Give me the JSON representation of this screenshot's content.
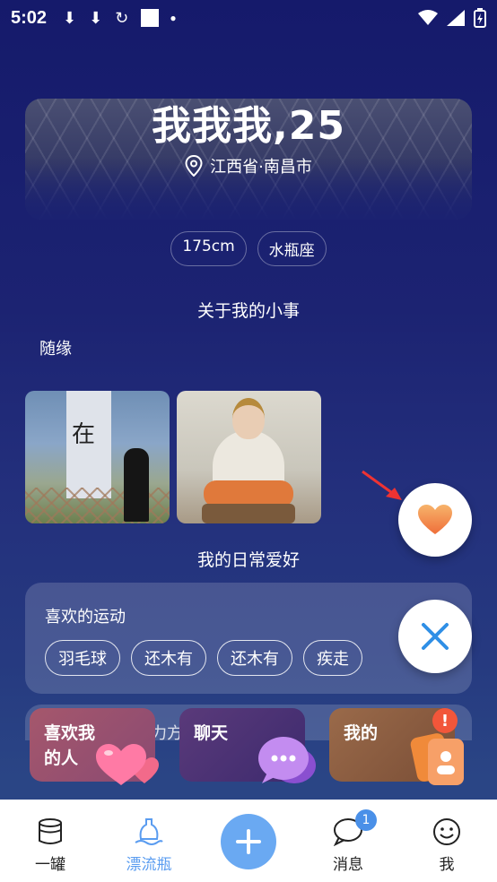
{
  "status_bar": {
    "time": "5:02"
  },
  "profile": {
    "name_age": "我我我,25",
    "location": "江西省·南昌市",
    "tags": [
      "175cm",
      "水瓶座"
    ]
  },
  "about": {
    "title": "关于我的小事",
    "text": "随缘"
  },
  "hobbies": {
    "title": "我的日常爱好",
    "sports_title": "喜欢的运动",
    "sports": [
      "羽毛球",
      "还木有",
      "还木有",
      "疾走"
    ],
    "next_title_partial": "力方"
  },
  "quick_actions": [
    {
      "label": "喜欢我的人",
      "icon": "hearts-icon"
    },
    {
      "label": "聊天",
      "icon": "chat-bubbles-icon"
    },
    {
      "label": "我的",
      "icon": "profile-card-icon"
    }
  ],
  "alert_badge": "!",
  "bottom_nav": {
    "items": [
      {
        "label": "一罐",
        "icon": "jar-icon"
      },
      {
        "label": "漂流瓶",
        "icon": "drift-bottle-icon",
        "active": true
      },
      {
        "label": "消息",
        "icon": "message-icon",
        "badge": "1"
      },
      {
        "label": "我",
        "icon": "smiley-icon"
      }
    ]
  },
  "colors": {
    "accent": "#5a9cf0",
    "like": "#f5a04a",
    "close": "#2f8fe6",
    "badge_alert": "#f2563a"
  }
}
